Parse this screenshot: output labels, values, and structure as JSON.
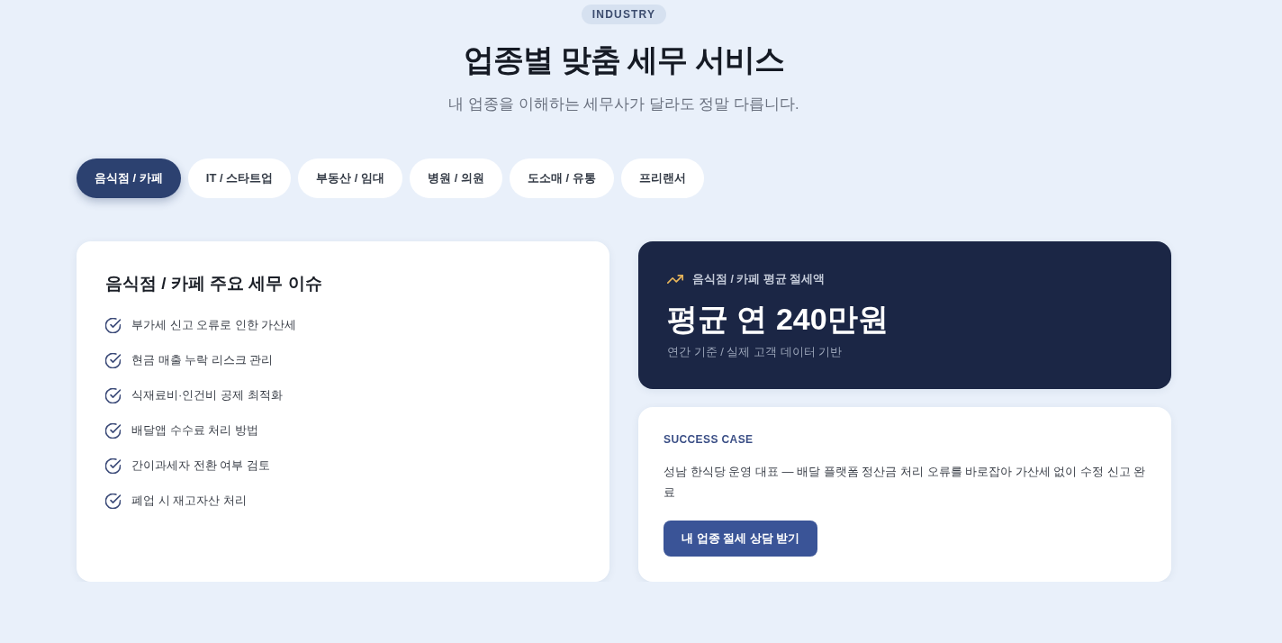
{
  "header": {
    "badge": "INDUSTRY",
    "title": "업종별 맞춤 세무 서비스",
    "subtitle": "내 업종을 이해하는 세무사가 달라도 정말 다릅니다."
  },
  "tabs": [
    {
      "label": "음식점 / 카페",
      "selected": true
    },
    {
      "label": "IT / 스타트업",
      "selected": false
    },
    {
      "label": "부동산 / 임대",
      "selected": false
    },
    {
      "label": "병원 / 의원",
      "selected": false
    },
    {
      "label": "도소매 / 유통",
      "selected": false
    },
    {
      "label": "프리랜서",
      "selected": false
    }
  ],
  "issues_card": {
    "title": "음식점 / 카페 주요 세무 이슈",
    "items": [
      "부가세 신고 오류로 인한 가산세",
      "현금 매출 누락 리스크 관리",
      "식재료비·인건비 공제 최적화",
      "배달앱 수수료 처리 방법",
      "간이과세자 전환 여부 검토",
      "폐업 시 재고자산 처리"
    ]
  },
  "savings_card": {
    "label": "음식점 / 카페 평균 절세액",
    "amount": "평균 연 240만원",
    "note": "연간 기준 / 실제 고객 데이터 기반"
  },
  "success_card": {
    "label": "SUCCESS CASE",
    "text": "성남 한식당 운영 대표 — 배달 플랫폼 정산금 처리 오류를 바로잡아 가산세 없이 수정 신고 완료",
    "button": "내 업종 절세 상담 받기"
  }
}
